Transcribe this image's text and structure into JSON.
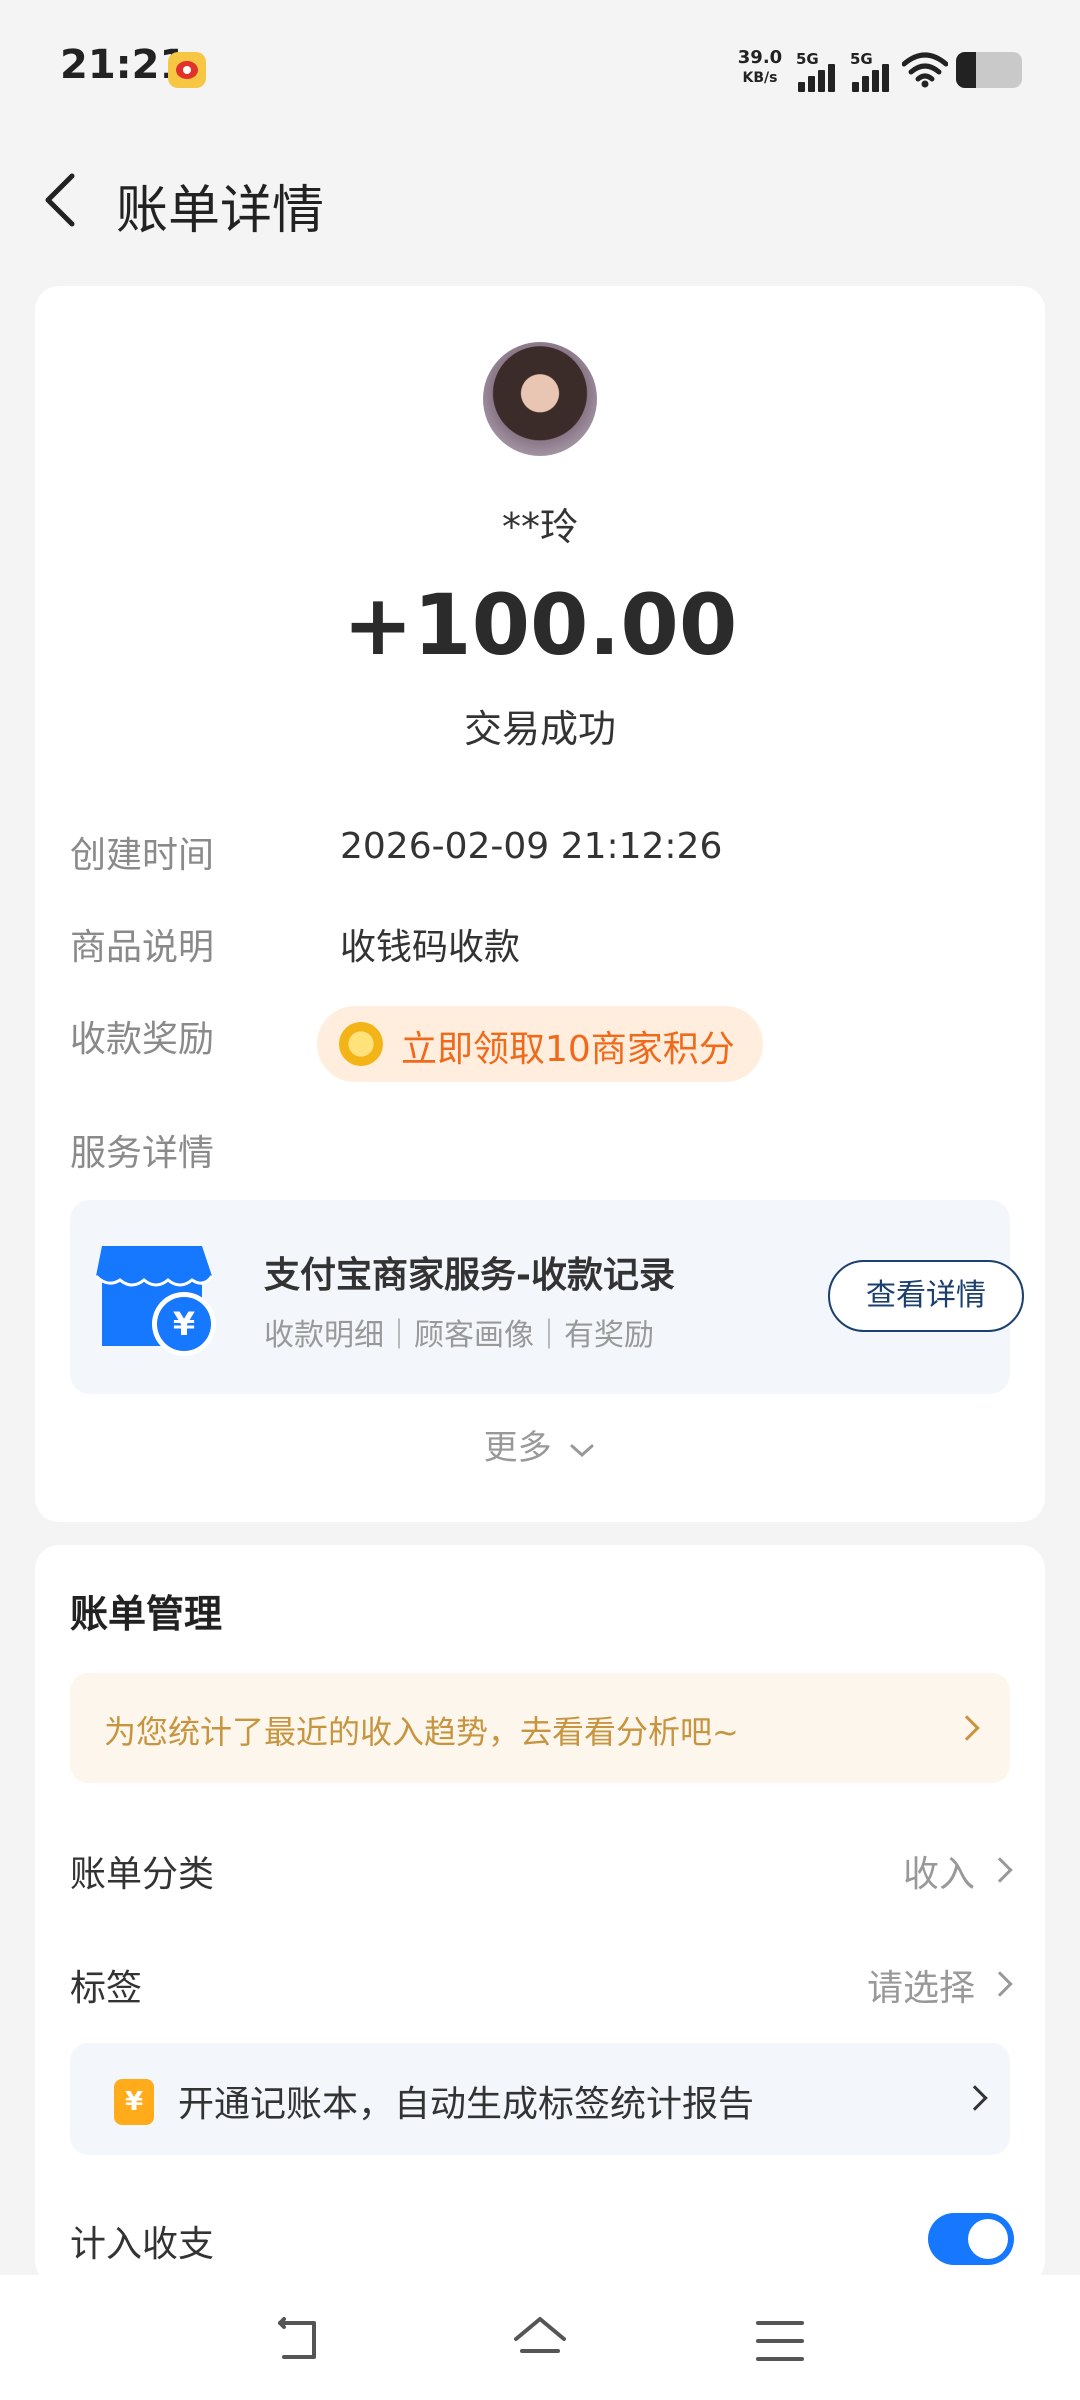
{
  "status_bar": {
    "time": "21:21",
    "app_icon": "weibo-icon",
    "net_speed_value": "39.0",
    "net_speed_unit": "KB/s",
    "sim1": "5G",
    "sim2": "5G",
    "battery_level": 0.3
  },
  "header": {
    "back_icon": "chevron-left-icon",
    "title": "账单详情"
  },
  "transaction": {
    "counterparty": "**玲",
    "amount": "+100.00",
    "status": "交易成功",
    "rows": [
      {
        "label": "创建时间",
        "value": "2026-02-09 21:12:26"
      },
      {
        "label": "商品说明",
        "value": "收钱码收款"
      }
    ],
    "reward_label": "收款奖励",
    "reward_text": "立即领取10商家积分",
    "service_label": "服务详情",
    "service": {
      "title": "支付宝商家服务-收款记录",
      "subtitle": "收款明细｜顾客画像｜有奖励",
      "button": "查看详情"
    },
    "more": "更多"
  },
  "bill_management": {
    "title": "账单管理",
    "tip": "为您统计了最近的收入趋势，去看看分析吧~",
    "category_label": "账单分类",
    "category_value": "收入",
    "tag_label": "标签",
    "tag_value": "请选择",
    "ledger_icon_text": "¥",
    "ledger_text": "开通记账本，自动生成标签统计报告",
    "include_label": "计入收支",
    "include_on": true
  },
  "nav": {
    "back": "back-icon",
    "home": "home-icon",
    "menu": "menu-icon"
  },
  "colors": {
    "accent_blue": "#1677ff",
    "reward_orange": "#f06a1c",
    "tip_gold": "#c79540",
    "service_button": "#1b3f6e"
  }
}
